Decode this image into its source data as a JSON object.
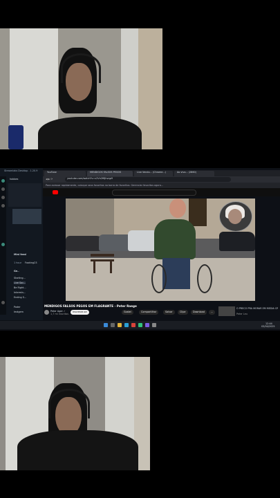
{
  "browser": {
    "tabs": [
      "YouTube",
      "MENDIGOS FALSOS PEGOS",
      "Live Vendo... (Chrome...)",
      "Ao vivo... (2860)"
    ],
    "url": "youtube.com/watch?v=v2Vn2f6Jhvqp9",
    "bookmark_text": "Para acessar rapidamente, coloque seus favoritos na barra de favoritos. Gerenciar favoritos agora..."
  },
  "left_app": {
    "title": "Streamlabs Desktop - 1.20.9",
    "user": "hobbes",
    "feed_title": "Mini feed",
    "feed_tab": "1 hour",
    "feed_user": "Fooking23",
    "chat_title": "Ge..",
    "items": [
      "Starting...",
      "Live Soc...",
      "Be Right...",
      "Intermis...",
      "Ending S...",
      "Poder",
      "Imágem"
    ]
  },
  "youtube": {
    "video_title": "MENDIGOS FALSOS PEGOS EM FLAGRANTE - Peter Raege",
    "channel": "Peter Ager ✓",
    "subscribers": "1,7 mi inscritos",
    "subscribe_label": "Inscrever-se",
    "actions": [
      "Gostei",
      "Compartilhar",
      "Salvar",
      "Clipe",
      "Download",
      "..."
    ],
    "side_title": "O PRECO PRA MORAR EM MEDIA CRUSTAMENTOS DO...",
    "side_channel": "Peter Leu"
  },
  "taskbar": {
    "clock_time": "12:44",
    "clock_date": "03/04/2025"
  }
}
